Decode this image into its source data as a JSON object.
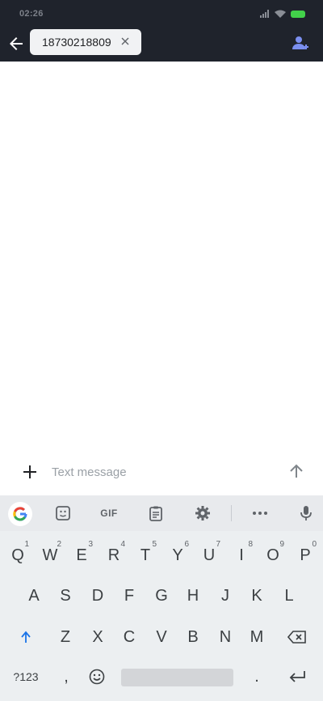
{
  "status_bar": {
    "time": "02:26"
  },
  "header": {
    "recipient_chip": "18730218809",
    "chip_remove_icon": "close-icon",
    "contact_icon": "add-contact-icon"
  },
  "composer": {
    "placeholder": "Text message",
    "attach_icon": "plus-icon",
    "send_icon": "send-arrow-icon"
  },
  "keyboard": {
    "toolbar": {
      "google": "G",
      "gif": "GIF"
    },
    "row1": [
      {
        "k": "Q",
        "h": "1"
      },
      {
        "k": "W",
        "h": "2"
      },
      {
        "k": "E",
        "h": "3"
      },
      {
        "k": "R",
        "h": "4"
      },
      {
        "k": "T",
        "h": "5"
      },
      {
        "k": "Y",
        "h": "6"
      },
      {
        "k": "U",
        "h": "7"
      },
      {
        "k": "I",
        "h": "8"
      },
      {
        "k": "O",
        "h": "9"
      },
      {
        "k": "P",
        "h": "0"
      }
    ],
    "row2": [
      "A",
      "S",
      "D",
      "F",
      "G",
      "H",
      "J",
      "K",
      "L"
    ],
    "row3": [
      "Z",
      "X",
      "C",
      "V",
      "B",
      "N",
      "M"
    ],
    "row4": {
      "symbols": "?123",
      "comma": ",",
      "period": "."
    },
    "colors": {
      "accent": "#1a73e8",
      "bg": "#eceff1"
    }
  }
}
